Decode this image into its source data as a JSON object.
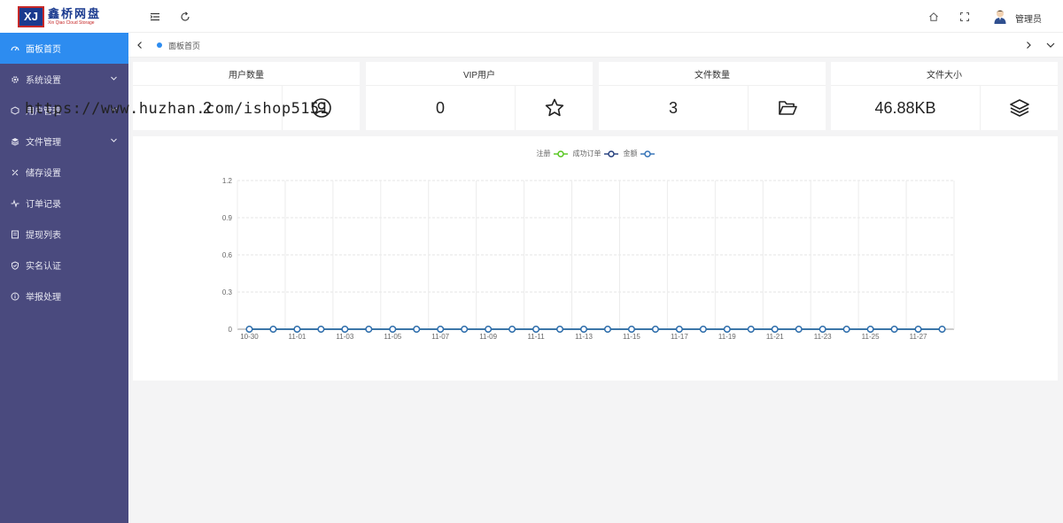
{
  "brand": {
    "logo_mark": "XJ",
    "title": "鑫桥网盘",
    "subtitle": "Xin Qiao Cloud Storage"
  },
  "sidebar": {
    "items": [
      {
        "label": "面板首页",
        "icon": "dashboard-icon",
        "active": true,
        "expandable": false
      },
      {
        "label": "系统设置",
        "icon": "gear-icon",
        "active": false,
        "expandable": true
      },
      {
        "label": "用户管理",
        "icon": "users-icon",
        "active": false,
        "expandable": true
      },
      {
        "label": "文件管理",
        "icon": "layers-icon",
        "active": false,
        "expandable": true
      },
      {
        "label": "储存设置",
        "icon": "storage-icon",
        "active": false,
        "expandable": false
      },
      {
        "label": "订单记录",
        "icon": "activity-icon",
        "active": false,
        "expandable": false
      },
      {
        "label": "提现列表",
        "icon": "list-icon",
        "active": false,
        "expandable": false
      },
      {
        "label": "实名认证",
        "icon": "shield-icon",
        "active": false,
        "expandable": false
      },
      {
        "label": "举报处理",
        "icon": "info-icon",
        "active": false,
        "expandable": false
      }
    ]
  },
  "header": {
    "user_name": "管理员"
  },
  "tabs": {
    "active_label": "面板首页"
  },
  "stats": [
    {
      "title": "用户数量",
      "value": "2",
      "icon": "user-circle-icon"
    },
    {
      "title": "VIP用户",
      "value": "0",
      "icon": "star-icon"
    },
    {
      "title": "文件数量",
      "value": "3",
      "icon": "folder-open-icon"
    },
    {
      "title": "文件大小",
      "value": "46.88KB",
      "icon": "stack-icon"
    }
  ],
  "watermark": "https://www.huzhan.com/ishop5151",
  "chart_data": {
    "type": "line",
    "x": [
      "10-30",
      "10-31",
      "11-01",
      "11-02",
      "11-03",
      "11-04",
      "11-05",
      "11-06",
      "11-07",
      "11-08",
      "11-09",
      "11-10",
      "11-11",
      "11-12",
      "11-13",
      "11-14",
      "11-15",
      "11-16",
      "11-17",
      "11-18",
      "11-19",
      "11-20",
      "11-21",
      "11-22",
      "11-23",
      "11-24",
      "11-25",
      "11-26",
      "11-27",
      "11-28"
    ],
    "x_tick_labels": [
      "10-30",
      "11-01",
      "11-03",
      "11-05",
      "11-07",
      "11-09",
      "11-11",
      "11-13",
      "11-15",
      "11-17",
      "11-19",
      "11-21",
      "11-23",
      "11-25",
      "11-27"
    ],
    "ylim": [
      0,
      1.2
    ],
    "yticks": [
      0,
      0.3,
      0.6,
      0.9,
      1.2
    ],
    "grid": true,
    "legend_position": "top-center",
    "series": [
      {
        "name": "注册",
        "color": "#52c41a",
        "values": [
          0,
          0,
          0,
          0,
          0,
          0,
          0,
          0,
          0,
          0,
          0,
          0,
          0,
          0,
          0,
          0,
          0,
          0,
          0,
          0,
          0,
          0,
          0,
          0,
          0,
          0,
          0,
          0,
          0,
          0
        ]
      },
      {
        "name": "成功订单",
        "color": "#1f3a7a",
        "values": [
          0,
          0,
          0,
          0,
          0,
          0,
          0,
          0,
          0,
          0,
          0,
          0,
          0,
          0,
          0,
          0,
          0,
          0,
          0,
          0,
          0,
          0,
          0,
          0,
          0,
          0,
          0,
          0,
          0,
          0
        ]
      },
      {
        "name": "金额",
        "color": "#2f6fb5",
        "values": [
          0,
          0,
          0,
          0,
          0,
          0,
          0,
          0,
          0,
          0,
          0,
          0,
          0,
          0,
          0,
          0,
          0,
          0,
          0,
          0,
          0,
          0,
          0,
          0,
          0,
          0,
          0,
          0,
          0,
          0
        ]
      }
    ]
  }
}
